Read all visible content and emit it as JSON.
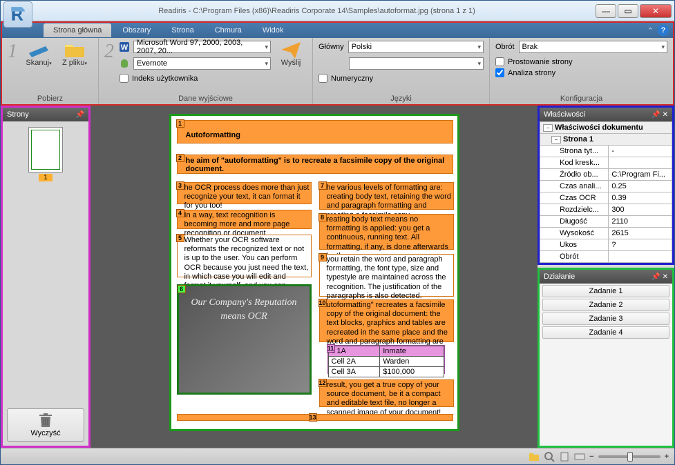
{
  "title": "Readiris - C:\\Program Files (x86)\\Readiris Corporate 14\\Samples\\autoformat.jpg (strona 1 z 1)",
  "tabs": [
    "Strona główna",
    "Obszary",
    "Strona",
    "Chmura",
    "Widok"
  ],
  "ribbon": {
    "retrieve": {
      "label": "Pobierz",
      "scan": "Skanuj",
      "fromfile": "Z pliku"
    },
    "output": {
      "label": "Dane wyjściowe",
      "format": "Microsoft Word 97, 2000, 2003, 2007, 20...",
      "dest": "Evernote",
      "userindex": "Indeks użytkownika",
      "send": "Wyślij"
    },
    "languages": {
      "label": "Języki",
      "main_label": "Główny",
      "main_value": "Polski",
      "numeric": "Numeryczny"
    },
    "config": {
      "label": "Konfiguracja",
      "rotation_label": "Obrót",
      "rotation_value": "Brak",
      "deskew": "Prostowanie strony",
      "pageanalysis": "Analiza strony"
    }
  },
  "panels": {
    "pages": "Strony",
    "properties": "Właściwości",
    "actions": "Działanie",
    "clear": "Wyczyść",
    "thumb_num": "1"
  },
  "properties": {
    "doc_header": "Właściwości dokumentu",
    "page_header": "Strona 1",
    "rows": [
      {
        "k": "Strona tyt...",
        "v": "-"
      },
      {
        "k": "Kod kresk...",
        "v": ""
      },
      {
        "k": "Źródło ob...",
        "v": "C:\\Program Fi..."
      },
      {
        "k": "Czas anali...",
        "v": "0.25"
      },
      {
        "k": "Czas OCR",
        "v": "0.39"
      },
      {
        "k": "Rozdzielc...",
        "v": "300"
      },
      {
        "k": "Długość",
        "v": "2110"
      },
      {
        "k": "Wysokość",
        "v": "2615"
      },
      {
        "k": "Ukos",
        "v": "?"
      },
      {
        "k": "Obrót",
        "v": ""
      }
    ]
  },
  "actions": [
    "Zadanie 1",
    "Zadanie 2",
    "Zadanie 3",
    "Zadanie 4"
  ],
  "document": {
    "title": "Autoformatting",
    "subtitle": "he aim of \"autoformatting\" is to recreate a facsimile copy of the original document.",
    "z3": "he OCR process does more than just recognize your text, it can format it for you too!",
    "z4": "In a way, text recognition is becoming more and more page recognition or document recognition...",
    "z5": "Whether your OCR software reformats the recognized text or not is up to the user. You can perform OCR because you just need the text, in which case you will edit and format it yourself, and you can recreate the source document, including its formatting.",
    "z7": "he various levels of formatting are: creating body text, retaining the word and paragraph formatting and creating a facsimile copy.",
    "z8": "reating body text means no formatting is applied: you get a continuous, running text. All formatting, if any, is done afterwards by the user.",
    "z9": "you retain the word and paragraph formatting, the font type, size and typestyle are maintained across the recognition. The justification of the paragraphs is also detected. However, no graphics are captured and the columns aren't recreated - the paragraph just follow each other etc.",
    "z10": "utoformatting\" recreates a facsimile copy of the original document: the text blocks, graphics and tables are recreated in the same place and the word and paragraph formatting are maintained across the recognition.",
    "z12": "result, you get a true copy of your source document, be it a compact and editable text file, no longer a scanned image of your document!",
    "img_text": "Our Company's Reputation means OCR",
    "table": {
      "h1": "ll 1A",
      "h2": "Inmate",
      "r1c1": "Cell 2A",
      "r1c2": "Warden",
      "r2c1": "Cell 3A",
      "r2c2": "$100,000"
    }
  }
}
